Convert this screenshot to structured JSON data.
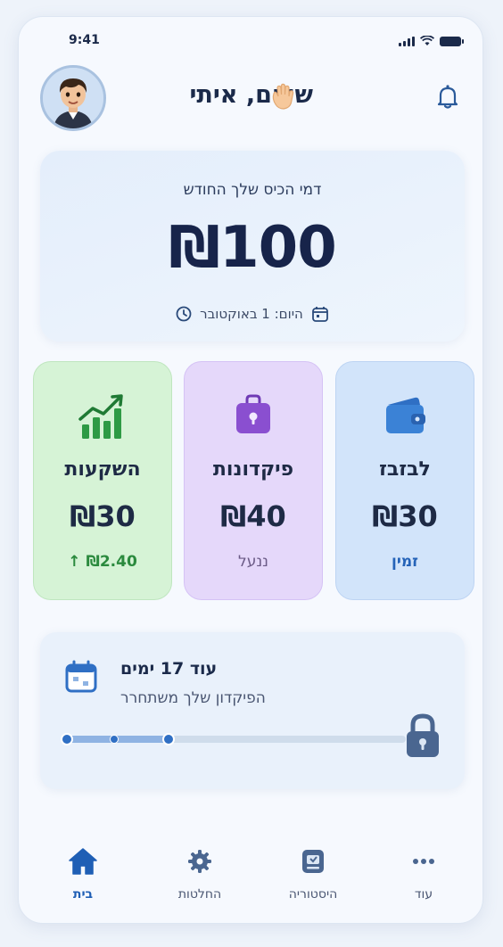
{
  "status_bar": {
    "time": "9:41"
  },
  "header": {
    "greeting": "שלום, איתי",
    "avatar_icon": "child-avatar",
    "wave_icon": "waving-hand-icon",
    "notification_icon": "bell-icon"
  },
  "pocket_money": {
    "label": "דמי הכיס שלך החודש",
    "amount": "₪100",
    "date_text": "היום: 1 באוקטובר"
  },
  "tiles": [
    {
      "title": "השקעות",
      "amount": "₪30",
      "sub": "₪2.40",
      "sub_icon": "arrow-up-icon",
      "icon": "growth-chart-icon",
      "color": "#d6f3d6"
    },
    {
      "title": "פיקדונות",
      "amount": "₪40",
      "sub": "ננעל",
      "icon": "locked-box-icon",
      "color": "#e5d8fa"
    },
    {
      "title": "לבזבז",
      "amount": "₪30",
      "sub": "זמין",
      "icon": "wallet-icon",
      "color": "#d2e4fa"
    }
  ],
  "deposit_lock": {
    "title": "עוד 17 ימים",
    "subtitle": "הפיקדון שלך משתחרר",
    "progress": 0.3
  },
  "tabbar": {
    "items": [
      {
        "label": "בית",
        "icon": "home-icon",
        "active": true
      },
      {
        "label": "החלטות",
        "icon": "gear-icon",
        "active": false
      },
      {
        "label": "היסטוריה",
        "icon": "history-icon",
        "active": false
      },
      {
        "label": "עוד",
        "icon": "more-icon",
        "active": false
      }
    ]
  },
  "colors": {
    "accent": "#1f5fb5",
    "background": "#f6f9fe"
  }
}
